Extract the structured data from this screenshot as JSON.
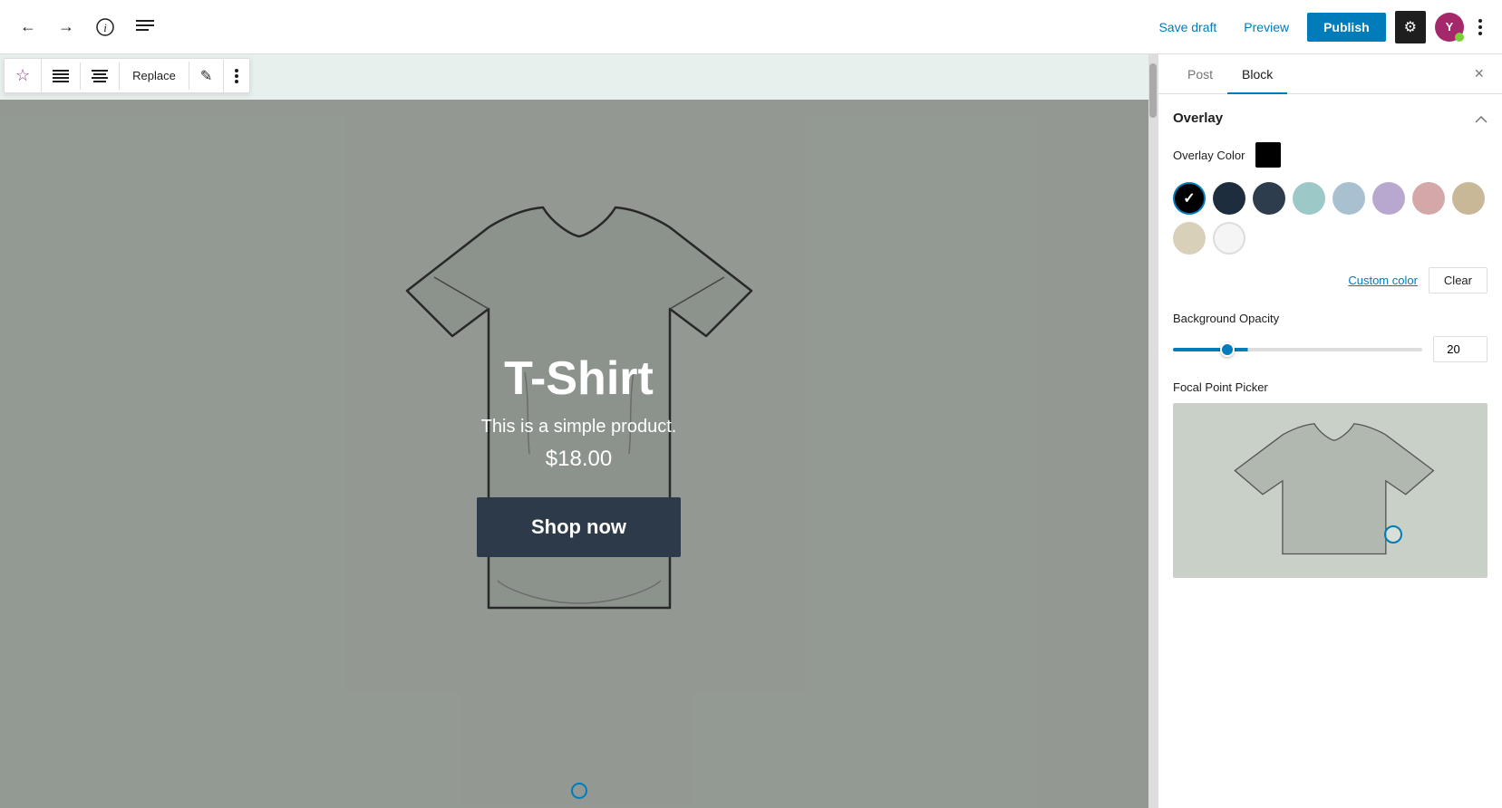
{
  "header": {
    "back_label": "←",
    "forward_label": "→",
    "info_label": "ℹ",
    "menu_label": "≡",
    "save_draft": "Save draft",
    "preview": "Preview",
    "publish": "Publish",
    "settings_icon": "⚙",
    "more_icon": "⋮",
    "yoast_letter": "Y"
  },
  "block_toolbar": {
    "star_icon": "☆",
    "align_left_icon": "▤",
    "align_center_icon": "▥",
    "replace_label": "Replace",
    "pencil_icon": "✎",
    "more_icon": "⋮"
  },
  "product": {
    "title": "T-Shirt",
    "description": "This is a simple product.",
    "price": "$18.00",
    "button_label": "Shop now"
  },
  "panel": {
    "tab_post": "Post",
    "tab_block": "Block",
    "close_icon": "×",
    "overlay_section_title": "Overlay",
    "toggle_icon": "∧",
    "overlay_color_label": "Overlay Color",
    "color_swatches": [
      {
        "id": "black",
        "color": "#000000",
        "selected": true
      },
      {
        "id": "dark-navy",
        "color": "#1e2d3d",
        "selected": false
      },
      {
        "id": "slate",
        "color": "#2d3d4d",
        "selected": false
      },
      {
        "id": "mint",
        "color": "#9dc8c8",
        "selected": false
      },
      {
        "id": "light-blue",
        "color": "#a8c0d0",
        "selected": false
      },
      {
        "id": "lavender",
        "color": "#b8a8d0",
        "selected": false
      },
      {
        "id": "blush",
        "color": "#d4a8a8",
        "selected": false
      },
      {
        "id": "tan",
        "color": "#c8b898",
        "selected": false
      },
      {
        "id": "cream",
        "color": "#d8d0b8",
        "selected": false
      },
      {
        "id": "white",
        "color": "#f5f5f5",
        "selected": false
      }
    ],
    "custom_color_label": "Custom color",
    "clear_label": "Clear",
    "background_opacity_label": "Background Opacity",
    "opacity_value": "20",
    "focal_point_label": "Focal Point Picker"
  }
}
